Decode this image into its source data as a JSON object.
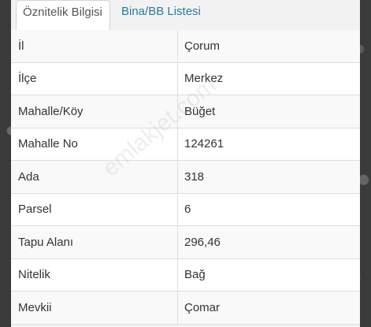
{
  "tabs": [
    {
      "label": "Öznitelik Bilgisi",
      "active": true
    },
    {
      "label": "Bina/BB Listesi",
      "active": false
    }
  ],
  "rows": [
    {
      "label": "İl",
      "value": "Çorum"
    },
    {
      "label": "İlçe",
      "value": "Merkez"
    },
    {
      "label": "Mahalle/Köy",
      "value": "Büğet"
    },
    {
      "label": "Mahalle No",
      "value": "124261"
    },
    {
      "label": "Ada",
      "value": "318"
    },
    {
      "label": "Parsel",
      "value": "6"
    },
    {
      "label": "Tapu Alanı",
      "value": "296,46"
    },
    {
      "label": "Nitelik",
      "value": "Bağ"
    },
    {
      "label": "Mevkii",
      "value": "Çomar"
    }
  ],
  "watermark": "emlakjet.com",
  "colors": {
    "tab_link": "#2a7aa0",
    "text": "#333333",
    "row_alt": "#f9f9f9",
    "border": "#dddddd"
  }
}
